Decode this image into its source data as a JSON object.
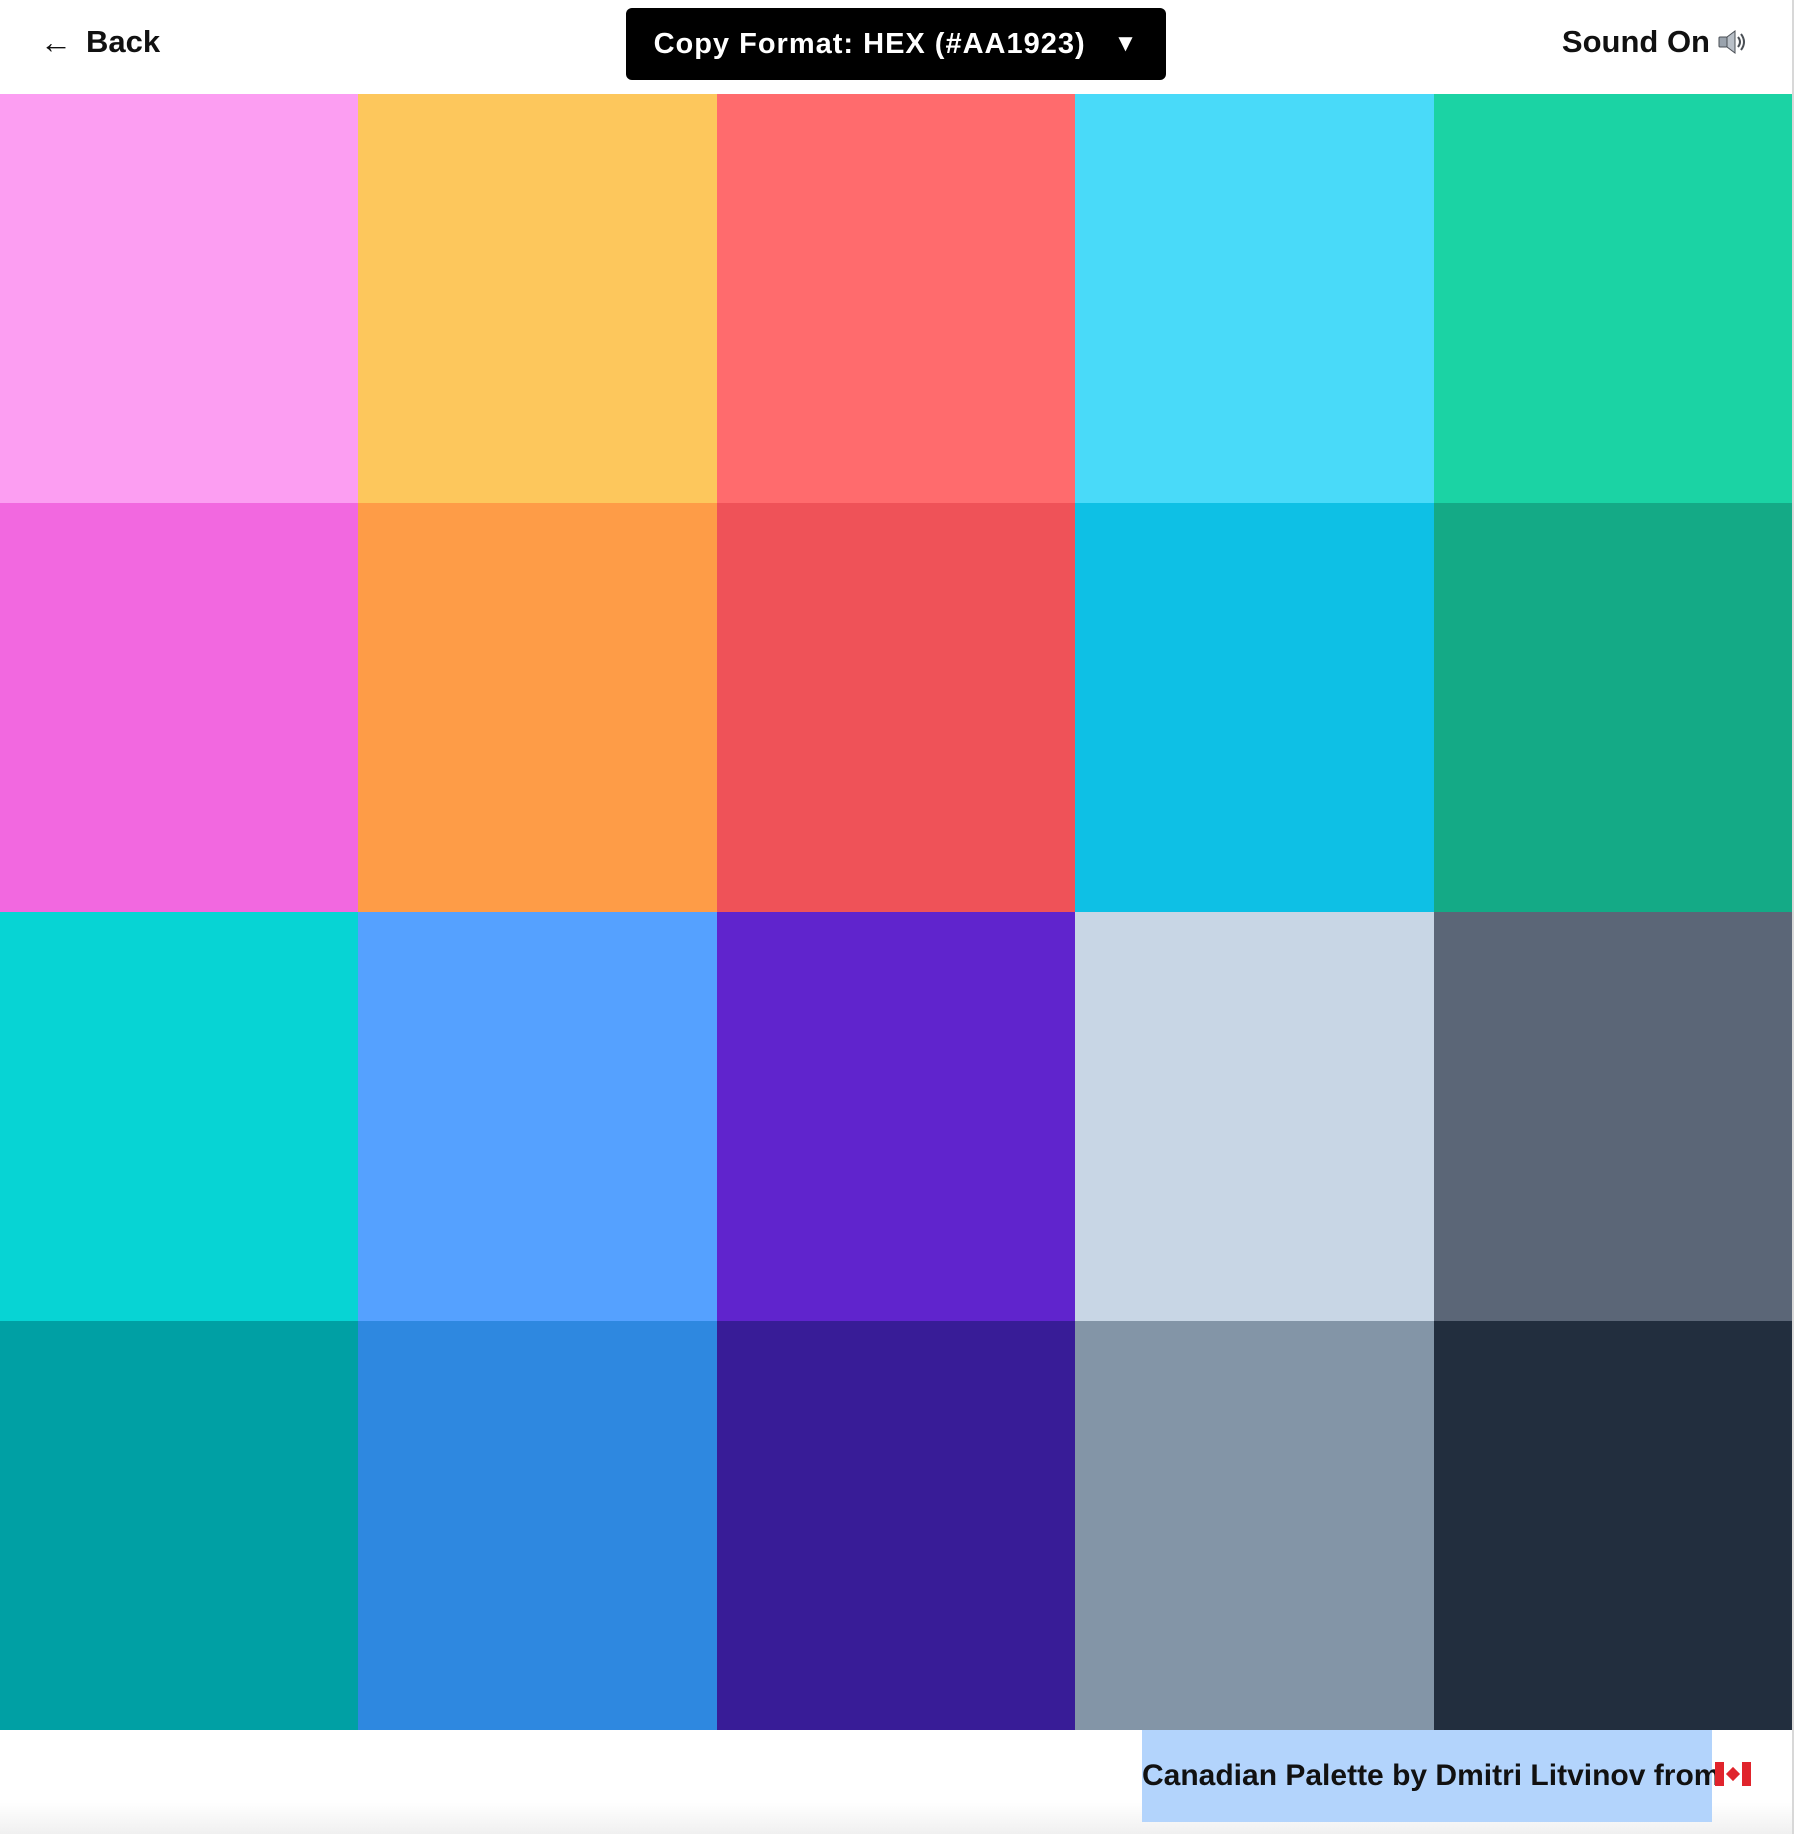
{
  "header": {
    "back_label": "Back",
    "back_arrow": "←",
    "format_label": "Copy Format: HEX (#AA1923)",
    "format_caret": "▼",
    "sound_label": "Sound On"
  },
  "icons": {
    "back": "left-arrow-icon",
    "format": "caret-down-icon",
    "sound": "speaker-icon",
    "flag": "canada-flag-icon"
  },
  "palette": {
    "colors": [
      "#fc9ef2",
      "#fdc75c",
      "#ff6b6d",
      "#49daf9",
      "#1bd3a4",
      "#f268e0",
      "#fe9c47",
      "#ef5258",
      "#0ec0e5",
      "#14aa86",
      "#07d4d4",
      "#55a1ff",
      "#6024cd",
      "#c8d6e5",
      "#5b6677",
      "#00a0a4",
      "#2e88e0",
      "#381c97",
      "#8395a7",
      "#222e3e"
    ]
  },
  "footer": {
    "credit": "Canadian Palette by Dmitri Litvinov from",
    "selection_color": "#b3d4fc"
  }
}
